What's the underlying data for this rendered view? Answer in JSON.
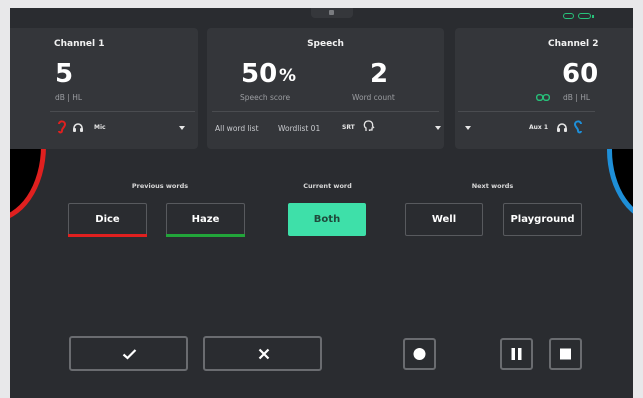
{
  "statusbar": {
    "grabber_icon": "drag-handle-icon",
    "link_icon": "link-icon",
    "battery_icon": "battery-icon",
    "accent_color": "#27c27a"
  },
  "channel1": {
    "title": "Channel 1",
    "level": "5",
    "unit": "dB | HL",
    "side_color": "#e0201f",
    "transducer_label": "Mic"
  },
  "speech": {
    "title": "Speech",
    "score_value": "50",
    "score_unit": "%",
    "score_label": "Speech score",
    "count_value": "2",
    "count_label": "Word count",
    "word_list_label": "All word list",
    "word_list_value": "Wordlist 01",
    "mode_label": "SRT"
  },
  "channel2": {
    "title": "Channel 2",
    "level": "60",
    "unit": "dB | HL",
    "side_color": "#1e8fd8",
    "input_label": "Aux 1"
  },
  "words": {
    "previous_label": "Previous words",
    "current_label": "Current word",
    "next_label": "Next words",
    "previous": [
      {
        "label": "Dice",
        "result_color": "#e0201f"
      },
      {
        "label": "Haze",
        "result_color": "#22a53a"
      }
    ],
    "current": {
      "label": "Both",
      "color": "#3ee0a9"
    },
    "next": [
      {
        "label": "Well"
      },
      {
        "label": "Playground"
      }
    ]
  },
  "actions": {
    "correct_icon": "checkmark-icon",
    "incorrect_icon": "close-icon",
    "record_icon": "record-icon",
    "pause_icon": "pause-icon",
    "stop_icon": "stop-icon"
  }
}
